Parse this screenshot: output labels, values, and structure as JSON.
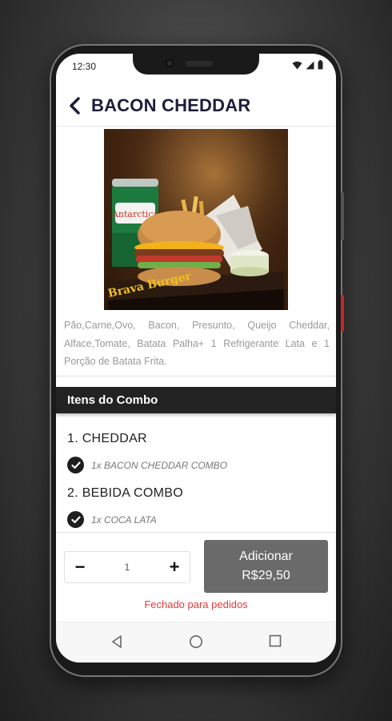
{
  "status_bar": {
    "time": "12:30"
  },
  "header": {
    "title": "BACON CHEDDAR"
  },
  "product": {
    "image_label": "Brava Burger",
    "can_label": "Antarctica",
    "description": "Pão,Carne,Ovo, Bacon, Presunto, Queijo Cheddar, Alface,Tomate, Batata Palha+ 1 Refrigerante Lata e 1 Porção de Batata Frita."
  },
  "combo": {
    "section_title": "Itens do Combo",
    "groups": [
      {
        "title": "1. CHEDDAR",
        "item": "1x BACON CHEDDAR COMBO"
      },
      {
        "title": "2. BEBIDA COMBO",
        "item": "1x COCA LATA"
      }
    ]
  },
  "order": {
    "minus": "−",
    "plus": "+",
    "quantity": "1",
    "add_label": "Adicionar",
    "price": "R$29,50",
    "closed_message": "Fechado para pedidos"
  },
  "colors": {
    "header_text": "#1b1f3a",
    "section_bar": "#222222",
    "add_button": "#6a6a6a",
    "closed_text": "#e53935"
  }
}
